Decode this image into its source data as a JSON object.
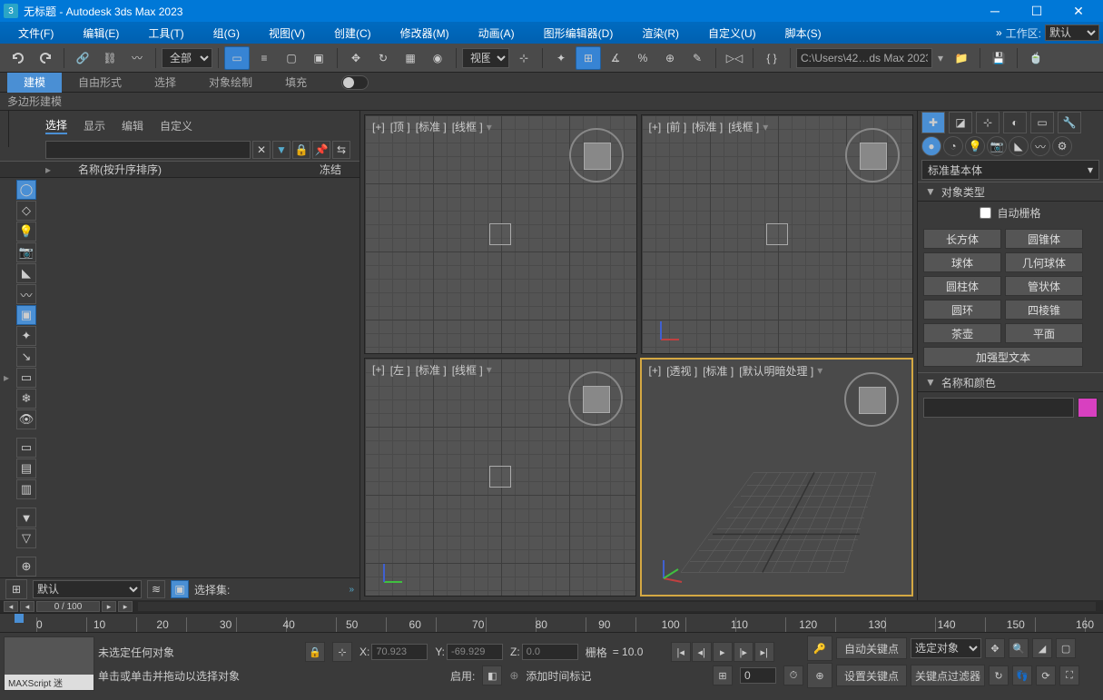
{
  "title": "无标题 - Autodesk 3ds Max 2023",
  "menu": [
    "文件(F)",
    "编辑(E)",
    "工具(T)",
    "组(G)",
    "视图(V)",
    "创建(C)",
    "修改器(M)",
    "动画(A)",
    "图形编辑器(D)",
    "渲染(R)",
    "自定义(U)",
    "脚本(S)"
  ],
  "workspace": {
    "label": "工作区:",
    "value": "默认"
  },
  "toolbar": {
    "filter_all": "全部",
    "viewsel": "视图",
    "path": "C:\\Users\\42…ds Max 2023"
  },
  "ribbon": {
    "tabs": [
      "建模",
      "自由形式",
      "选择",
      "对象绘制",
      "填充"
    ],
    "sub": "多边形建模"
  },
  "scene": {
    "tabs": [
      "选择",
      "显示",
      "编辑",
      "自定义"
    ],
    "search_placeholder": "",
    "cols": {
      "name": "名称(按升序排序)",
      "frozen": "冻结"
    },
    "layerset": "默认",
    "selset_label": "选择集:"
  },
  "viewports": {
    "top": {
      "plus": "[+]",
      "name": "[顶 ]",
      "std": "[标准 ]",
      "mode": "[线框 ]"
    },
    "front": {
      "plus": "[+]",
      "name": "[前 ]",
      "std": "[标准 ]",
      "mode": "[线框 ]"
    },
    "left": {
      "plus": "[+]",
      "name": "[左 ]",
      "std": "[标准 ]",
      "mode": "[线框 ]"
    },
    "persp": {
      "plus": "[+]",
      "name": "[透视 ]",
      "std": "[标准 ]",
      "mode": "[默认明暗处理 ]"
    }
  },
  "cmd": {
    "category": "标准基本体",
    "rollout_type": "对象类型",
    "autogrid": "自动栅格",
    "prims": [
      "长方体",
      "圆锥体",
      "球体",
      "几何球体",
      "圆柱体",
      "管状体",
      "圆环",
      "四棱锥",
      "茶壶",
      "平面",
      "加强型文本"
    ],
    "rollout_name": "名称和颜色",
    "name_value": ""
  },
  "timeline": {
    "frame": "0  /  100",
    "ruler": [
      "0",
      "10",
      "20",
      "30",
      "40",
      "50",
      "60",
      "70",
      "80",
      "90",
      "100",
      "110",
      "120",
      "130",
      "140",
      "150",
      "160"
    ]
  },
  "status": {
    "line1": "未选定任何对象",
    "line2": "单击或单击并拖动以选择对象",
    "x_lbl": "X:",
    "x": "70.923",
    "y_lbl": "Y:",
    "y": "-69.929",
    "z_lbl": "Z:",
    "z": "0.0",
    "grid_lbl": "栅格",
    "grid": "= 10.0",
    "enable": "启用:",
    "addtime": "添加时间标记",
    "autokey": "自动关键点",
    "selobj": "选定对象",
    "setkey": "设置关键点",
    "keyfilter": "关键点过滤器",
    "maxscript": "MAXScript 迷"
  }
}
